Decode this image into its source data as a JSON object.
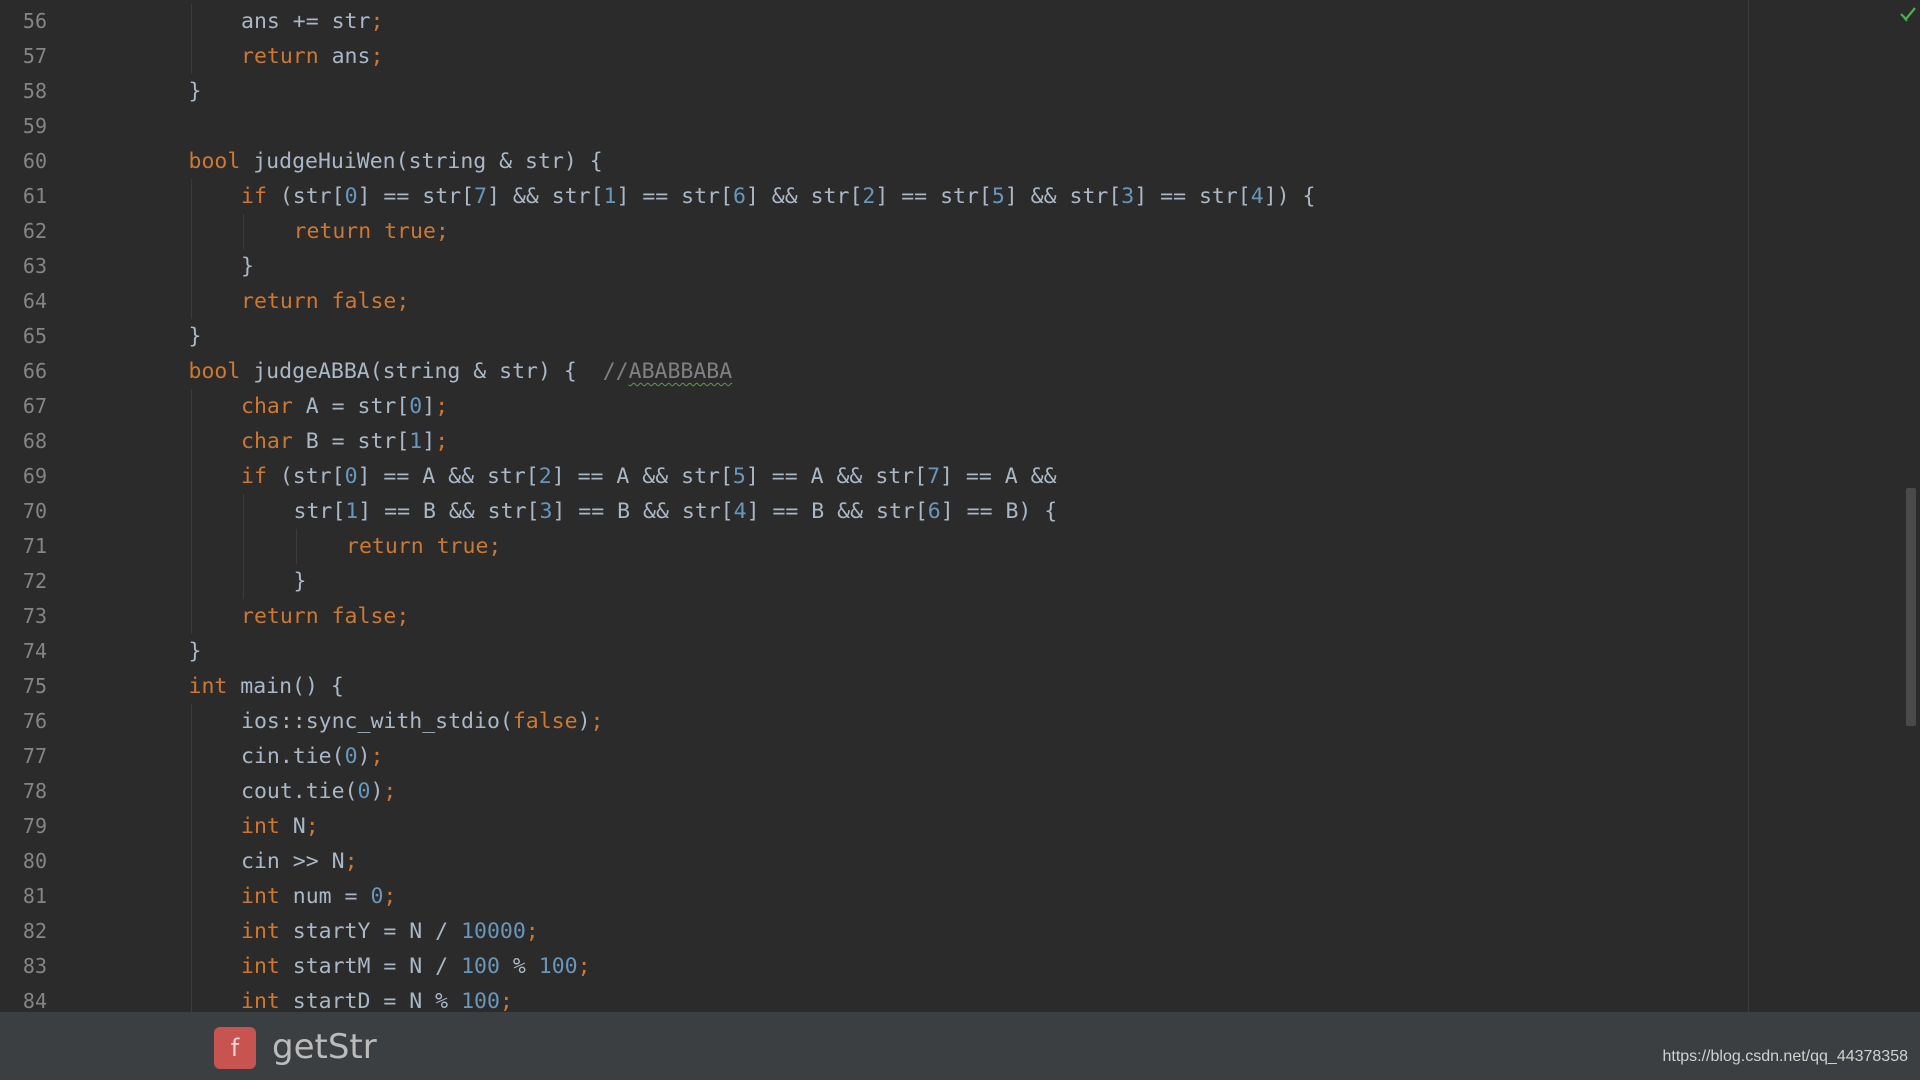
{
  "header_clip": "",
  "status": {
    "ok_icon": "checkmark-icon",
    "ok_color": "#4caf50"
  },
  "lines": [
    {
      "num": "56",
      "indent": 2,
      "tokens": [
        [
          "id",
          "ans += str"
        ],
        [
          "kw",
          ";"
        ]
      ]
    },
    {
      "num": "57",
      "indent": 2,
      "tokens": [
        [
          "kw",
          "return "
        ],
        [
          "id",
          "ans"
        ],
        [
          "kw",
          ";"
        ]
      ]
    },
    {
      "num": "58",
      "indent": 1,
      "tokens": [
        [
          "id",
          "}"
        ]
      ]
    },
    {
      "num": "59",
      "indent": 0,
      "tokens": []
    },
    {
      "num": "60",
      "indent": 1,
      "tokens": [
        [
          "kw",
          "bool "
        ],
        [
          "id",
          "judgeHuiWen(string & str) {"
        ]
      ]
    },
    {
      "num": "61",
      "indent": 2,
      "tokens": [
        [
          "kw",
          "if "
        ],
        [
          "id",
          "(str["
        ],
        [
          "num",
          "0"
        ],
        [
          "id",
          "] == str["
        ],
        [
          "num",
          "7"
        ],
        [
          "id",
          "] && str["
        ],
        [
          "num",
          "1"
        ],
        [
          "id",
          "] == str["
        ],
        [
          "num",
          "6"
        ],
        [
          "id",
          "] && str["
        ],
        [
          "num",
          "2"
        ],
        [
          "id",
          "] == str["
        ],
        [
          "num",
          "5"
        ],
        [
          "id",
          "] && str["
        ],
        [
          "num",
          "3"
        ],
        [
          "id",
          "] == str["
        ],
        [
          "num",
          "4"
        ],
        [
          "id",
          "]) {"
        ]
      ]
    },
    {
      "num": "62",
      "indent": 3,
      "tokens": [
        [
          "kw",
          "return true;"
        ]
      ]
    },
    {
      "num": "63",
      "indent": 2,
      "tokens": [
        [
          "id",
          "}"
        ]
      ]
    },
    {
      "num": "64",
      "indent": 2,
      "tokens": [
        [
          "kw",
          "return false;"
        ]
      ]
    },
    {
      "num": "65",
      "indent": 1,
      "tokens": [
        [
          "id",
          "}"
        ]
      ]
    },
    {
      "num": "66",
      "indent": 1,
      "tokens": [
        [
          "kw",
          "bool "
        ],
        [
          "id",
          "judgeABBA(string & str) {  "
        ],
        [
          "cm",
          "//"
        ],
        [
          "cmsq",
          "ABABBABA"
        ]
      ]
    },
    {
      "num": "67",
      "indent": 2,
      "tokens": [
        [
          "kw",
          "char "
        ],
        [
          "id",
          "A = str["
        ],
        [
          "num",
          "0"
        ],
        [
          "id",
          "]"
        ],
        [
          "kw",
          ";"
        ]
      ]
    },
    {
      "num": "68",
      "indent": 2,
      "tokens": [
        [
          "kw",
          "char "
        ],
        [
          "id",
          "B = str["
        ],
        [
          "num",
          "1"
        ],
        [
          "id",
          "]"
        ],
        [
          "kw",
          ";"
        ]
      ]
    },
    {
      "num": "69",
      "indent": 2,
      "tokens": [
        [
          "kw",
          "if "
        ],
        [
          "id",
          "(str["
        ],
        [
          "num",
          "0"
        ],
        [
          "id",
          "] == A && str["
        ],
        [
          "num",
          "2"
        ],
        [
          "id",
          "] == A && str["
        ],
        [
          "num",
          "5"
        ],
        [
          "id",
          "] == A && str["
        ],
        [
          "num",
          "7"
        ],
        [
          "id",
          "] == A &&"
        ]
      ]
    },
    {
      "num": "70",
      "indent": 3,
      "tokens": [
        [
          "id",
          "str["
        ],
        [
          "num",
          "1"
        ],
        [
          "id",
          "] == B && str["
        ],
        [
          "num",
          "3"
        ],
        [
          "id",
          "] == B && str["
        ],
        [
          "num",
          "4"
        ],
        [
          "id",
          "] == B && str["
        ],
        [
          "num",
          "6"
        ],
        [
          "id",
          "] == B) {"
        ]
      ]
    },
    {
      "num": "71",
      "indent": 4,
      "tokens": [
        [
          "kw",
          "return true;"
        ]
      ]
    },
    {
      "num": "72",
      "indent": 3,
      "tokens": [
        [
          "id",
          "}"
        ]
      ]
    },
    {
      "num": "73",
      "indent": 2,
      "tokens": [
        [
          "kw",
          "return false;"
        ]
      ]
    },
    {
      "num": "74",
      "indent": 1,
      "tokens": [
        [
          "id",
          "}"
        ]
      ]
    },
    {
      "num": "75",
      "indent": 1,
      "tokens": [
        [
          "kw",
          "int "
        ],
        [
          "id",
          "main() {"
        ]
      ]
    },
    {
      "num": "76",
      "indent": 2,
      "tokens": [
        [
          "id",
          "ios::sync_with_stdio("
        ],
        [
          "kw",
          "false"
        ],
        [
          "id",
          ")"
        ],
        [
          "kw",
          ";"
        ]
      ]
    },
    {
      "num": "77",
      "indent": 2,
      "tokens": [
        [
          "id",
          "cin.tie("
        ],
        [
          "num",
          "0"
        ],
        [
          "id",
          ")"
        ],
        [
          "kw",
          ";"
        ]
      ]
    },
    {
      "num": "78",
      "indent": 2,
      "tokens": [
        [
          "id",
          "cout.tie("
        ],
        [
          "num",
          "0"
        ],
        [
          "id",
          ")"
        ],
        [
          "kw",
          ";"
        ]
      ]
    },
    {
      "num": "79",
      "indent": 2,
      "tokens": [
        [
          "kw",
          "int "
        ],
        [
          "id",
          "N"
        ],
        [
          "kw",
          ";"
        ]
      ]
    },
    {
      "num": "80",
      "indent": 2,
      "tokens": [
        [
          "id",
          "cin >> N"
        ],
        [
          "kw",
          ";"
        ]
      ]
    },
    {
      "num": "81",
      "indent": 2,
      "tokens": [
        [
          "kw",
          "int "
        ],
        [
          "id",
          "num = "
        ],
        [
          "num",
          "0"
        ],
        [
          "kw",
          ";"
        ]
      ]
    },
    {
      "num": "82",
      "indent": 2,
      "tokens": [
        [
          "kw",
          "int "
        ],
        [
          "id",
          "startY = N / "
        ],
        [
          "num",
          "10000"
        ],
        [
          "kw",
          ";"
        ]
      ]
    },
    {
      "num": "83",
      "indent": 2,
      "tokens": [
        [
          "kw",
          "int "
        ],
        [
          "id",
          "startM = N / "
        ],
        [
          "num",
          "100"
        ],
        [
          "id",
          " % "
        ],
        [
          "num",
          "100"
        ],
        [
          "kw",
          ";"
        ]
      ]
    },
    {
      "num": "84",
      "indent": 2,
      "tokens": [
        [
          "kw",
          "int "
        ],
        [
          "id",
          "startD = N % "
        ],
        [
          "num",
          "100"
        ],
        [
          "kw",
          ";"
        ]
      ]
    }
  ],
  "breadcrumb": {
    "badge": "f",
    "function_name": "getStr",
    "badge_icon": "function-icon"
  },
  "watermark": "https://blog.csdn.net/qq_44378358",
  "colors": {
    "background": "#2b2b2b",
    "keyword": "#cc7832",
    "number": "#6897bb",
    "identifier": "#a9b7c6",
    "comment": "#808080",
    "badge": "#c75450"
  }
}
